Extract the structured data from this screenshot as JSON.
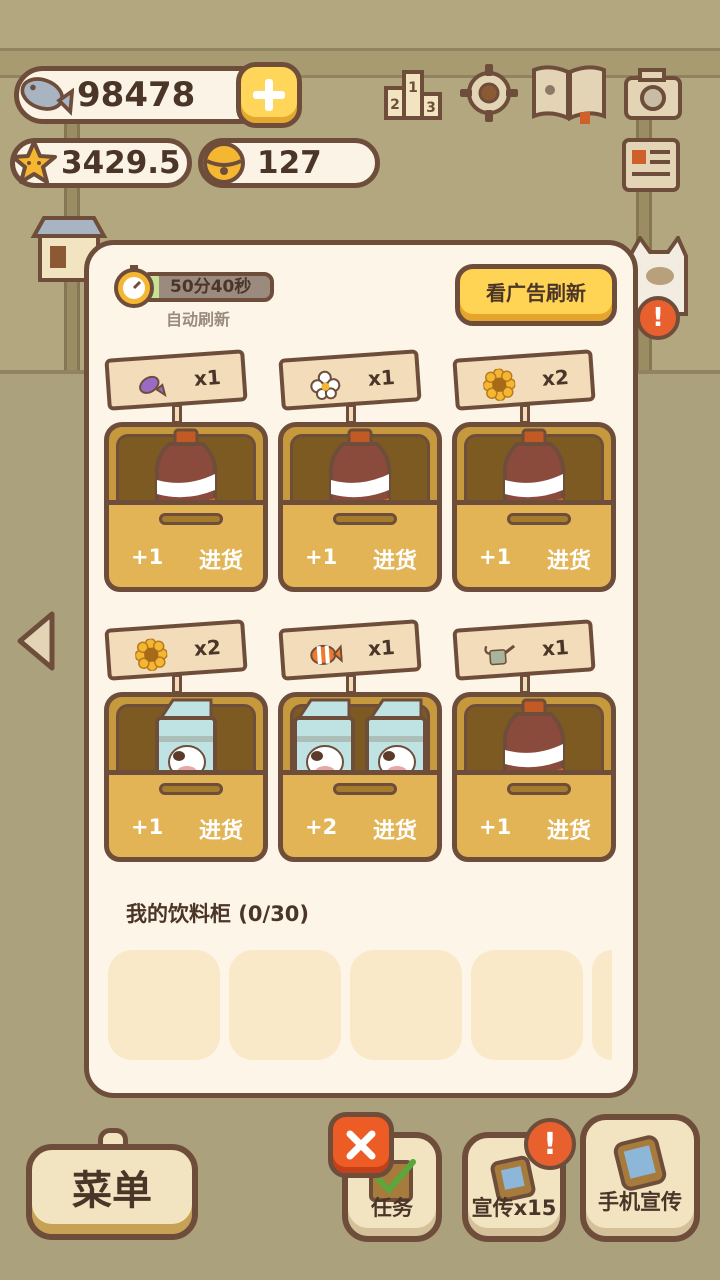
{
  "hud": {
    "fish_count": "98478",
    "star_count": "3429.5",
    "bell_count": "127"
  },
  "shop": {
    "timer_text": "50分40秒",
    "timer_progress": 0.12,
    "auto_refresh_label": "自动刷新",
    "ad_refresh_label": "看广告刷新",
    "restock_label": "进货",
    "crates": [
      {
        "sign_icon": "purple-fish-icon",
        "sign_qty": "x1",
        "product": "cola-bottle",
        "count": 1,
        "plus": "+1"
      },
      {
        "sign_icon": "white-flower-icon",
        "sign_qty": "x1",
        "product": "cola-bottle",
        "count": 1,
        "plus": "+1"
      },
      {
        "sign_icon": "sunflower-icon",
        "sign_qty": "x2",
        "product": "cola-bottle",
        "count": 1,
        "plus": "+1"
      },
      {
        "sign_icon": "sunflower-icon",
        "sign_qty": "x2",
        "product": "milk-carton",
        "count": 1,
        "plus": "+1"
      },
      {
        "sign_icon": "clownfish-icon",
        "sign_qty": "x1",
        "product": "milk-carton",
        "count": 2,
        "plus": "+2"
      },
      {
        "sign_icon": "watering-can-icon",
        "sign_qty": "x1",
        "product": "cola-bottle",
        "count": 1,
        "plus": "+1"
      }
    ]
  },
  "cabinet": {
    "label": "我的饮料柜 (0/30)"
  },
  "bottom": {
    "menu_label": "菜单",
    "tasks_label": "任务",
    "promo_label": "宣传x15",
    "phone_promo_label": "手机宣传"
  },
  "colors": {
    "outline": "#6e4e3b",
    "panel": "#fdf5e7",
    "accent_yellow": "#ffd354",
    "alert_orange": "#e8602e"
  }
}
